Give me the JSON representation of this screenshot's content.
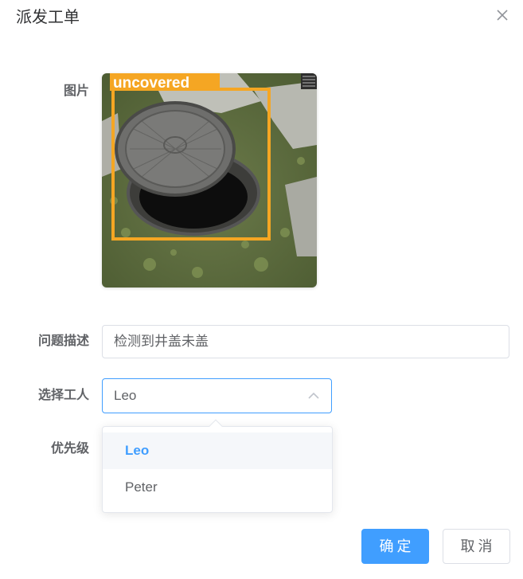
{
  "dialog": {
    "title": "派发工单",
    "close_icon": "close-icon"
  },
  "form": {
    "image_label": "图片",
    "image": {
      "detection_label": "uncovered",
      "detection_color": "#f5a623"
    },
    "description_label": "问题描述",
    "description_value": "检测到井盖未盖",
    "worker_label": "选择工人",
    "worker_value": "Leo",
    "worker_options": [
      "Leo",
      "Peter"
    ],
    "priority_label": "优先级"
  },
  "footer": {
    "confirm_label": "确定",
    "cancel_label": "取消"
  },
  "colors": {
    "primary": "#409eff",
    "text": "#303133",
    "muted": "#606266",
    "border": "#dcdfe6"
  }
}
